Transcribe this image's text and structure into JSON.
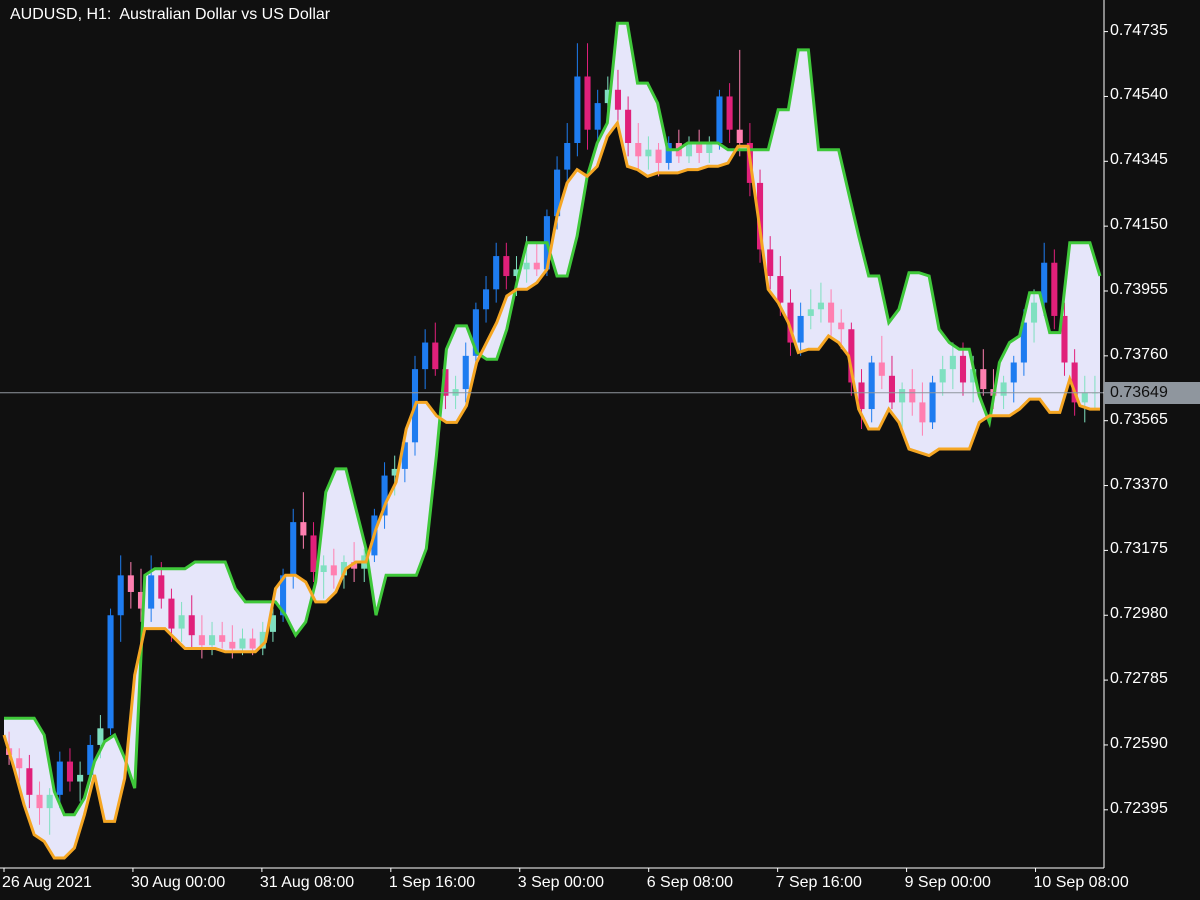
{
  "header": {
    "title": "AUDUSD, H1:  Australian Dollar vs US Dollar"
  },
  "colors": {
    "background": "#101010",
    "axis": "#ffffff",
    "band_fill": "#e6e6fa",
    "upper_band": "#3fc83a",
    "lower_band": "#f5a623",
    "bull_strong": "#1e7cf0",
    "bull_weak": "#7fe0c0",
    "bear_strong": "#e0207a",
    "bear_weak": "#ff7fb0",
    "neutral_candle": "#505050",
    "current_line": "#8f969e"
  },
  "chart_data": {
    "type": "candlestick-with-band",
    "symbol": "AUDUSD",
    "timeframe": "H1",
    "ylim": [
      0.7222,
      0.7483
    ],
    "y_ticks": [
      0.74735,
      0.7454,
      0.74345,
      0.7415,
      0.73955,
      0.7376,
      0.73565,
      0.7337,
      0.73175,
      0.7298,
      0.72785,
      0.7259,
      0.72395
    ],
    "y_tick_labels": [
      "0.74735",
      "0.74540",
      "0.74345",
      "0.74150",
      "0.73955",
      "0.73760",
      "0.73565",
      "0.73370",
      "0.73175",
      "0.72980",
      "0.72785",
      "0.72590",
      "0.72395"
    ],
    "x_tick_labels": [
      "26 Aug 2021",
      "30 Aug 00:00",
      "31 Aug 08:00",
      "1 Sep 16:00",
      "3 Sep 00:00",
      "6 Sep 08:00",
      "7 Sep 16:00",
      "9 Sep 00:00",
      "10 Sep 08:00"
    ],
    "current_price": 0.73649,
    "current_price_label": "0.73649",
    "series": [
      {
        "name": "upper",
        "values": [
          0.7267,
          0.7267,
          0.7267,
          0.7267,
          0.7262,
          0.7245,
          0.7238,
          0.7238,
          0.7243,
          0.7254,
          0.726,
          0.7262,
          0.7255,
          0.7246,
          0.731,
          0.7312,
          0.7312,
          0.7312,
          0.7312,
          0.7314,
          0.7314,
          0.7314,
          0.7314,
          0.7306,
          0.7302,
          0.7302,
          0.7302,
          0.7302,
          0.7298,
          0.7292,
          0.7296,
          0.7308,
          0.7335,
          0.7342,
          0.7342,
          0.733,
          0.7318,
          0.7298,
          0.731,
          0.731,
          0.731,
          0.731,
          0.7318,
          0.7346,
          0.7378,
          0.7385,
          0.7385,
          0.7377,
          0.7375,
          0.7375,
          0.7384,
          0.7398,
          0.741,
          0.741,
          0.741,
          0.74,
          0.74,
          0.7412,
          0.743,
          0.744,
          0.7446,
          0.7476,
          0.7476,
          0.7458,
          0.7458,
          0.7452,
          0.7438,
          0.7438,
          0.744,
          0.744,
          0.744,
          0.744,
          0.7438,
          0.7438,
          0.7438,
          0.7438,
          0.7438,
          0.745,
          0.745,
          0.7468,
          0.7468,
          0.7438,
          0.7438,
          0.7438,
          0.7425,
          0.7412,
          0.74,
          0.74,
          0.7386,
          0.739,
          0.7401,
          0.7401,
          0.74,
          0.7384,
          0.738,
          0.7378,
          0.7378,
          0.7364,
          0.7356,
          0.7374,
          0.738,
          0.7382,
          0.7395,
          0.7395,
          0.7383,
          0.7383,
          0.741,
          0.741,
          0.741,
          0.74
        ],
        "color_key": "upper_band"
      },
      {
        "name": "lower",
        "values": [
          0.7262,
          0.7252,
          0.7241,
          0.7232,
          0.723,
          0.7225,
          0.7225,
          0.7228,
          0.7238,
          0.725,
          0.7236,
          0.7236,
          0.7249,
          0.728,
          0.7294,
          0.7294,
          0.7294,
          0.7291,
          0.7288,
          0.7288,
          0.7288,
          0.7288,
          0.7287,
          0.7287,
          0.7287,
          0.7287,
          0.729,
          0.7306,
          0.731,
          0.731,
          0.7308,
          0.7302,
          0.7302,
          0.7305,
          0.7312,
          0.7314,
          0.7314,
          0.7324,
          0.7332,
          0.7338,
          0.7354,
          0.7362,
          0.7362,
          0.7358,
          0.7356,
          0.7356,
          0.7361,
          0.7374,
          0.738,
          0.7386,
          0.7394,
          0.7396,
          0.7396,
          0.7398,
          0.7402,
          0.7418,
          0.7428,
          0.7432,
          0.743,
          0.7433,
          0.7442,
          0.7446,
          0.7433,
          0.7432,
          0.743,
          0.7431,
          0.7431,
          0.7431,
          0.7432,
          0.7432,
          0.7433,
          0.7433,
          0.7434,
          0.7439,
          0.7439,
          0.7418,
          0.7396,
          0.7392,
          0.7386,
          0.7377,
          0.7378,
          0.7378,
          0.7382,
          0.738,
          0.7376,
          0.736,
          0.7354,
          0.7354,
          0.736,
          0.7356,
          0.7348,
          0.7347,
          0.7346,
          0.7348,
          0.7348,
          0.7348,
          0.7348,
          0.7356,
          0.7358,
          0.7358,
          0.7358,
          0.736,
          0.7363,
          0.7363,
          0.7359,
          0.7359,
          0.7369,
          0.7361,
          0.736,
          0.736
        ],
        "color_key": "lower_band"
      }
    ],
    "candles": [
      [
        0.7258,
        0.7263,
        0.7253,
        0.7256
      ],
      [
        0.7255,
        0.7258,
        0.7248,
        0.7252
      ],
      [
        0.7252,
        0.7256,
        0.724,
        0.7244
      ],
      [
        0.7244,
        0.7248,
        0.7235,
        0.724
      ],
      [
        0.724,
        0.7246,
        0.7232,
        0.7244
      ],
      [
        0.7244,
        0.7257,
        0.724,
        0.7254
      ],
      [
        0.7254,
        0.7258,
        0.7245,
        0.7248
      ],
      [
        0.7248,
        0.7254,
        0.7242,
        0.725
      ],
      [
        0.725,
        0.7262,
        0.7248,
        0.7259
      ],
      [
        0.7259,
        0.7268,
        0.7255,
        0.7264
      ],
      [
        0.7264,
        0.73,
        0.7262,
        0.7298
      ],
      [
        0.7298,
        0.7316,
        0.729,
        0.731
      ],
      [
        0.731,
        0.7314,
        0.73,
        0.7305
      ],
      [
        0.7305,
        0.7312,
        0.7296,
        0.73
      ],
      [
        0.73,
        0.7316,
        0.7296,
        0.731
      ],
      [
        0.731,
        0.7314,
        0.73,
        0.7303
      ],
      [
        0.7303,
        0.7306,
        0.729,
        0.7294
      ],
      [
        0.7294,
        0.7302,
        0.729,
        0.7298
      ],
      [
        0.7298,
        0.7304,
        0.7288,
        0.7292
      ],
      [
        0.7292,
        0.7298,
        0.7285,
        0.7289
      ],
      [
        0.7289,
        0.7296,
        0.7286,
        0.7292
      ],
      [
        0.7292,
        0.7296,
        0.7288,
        0.729
      ],
      [
        0.729,
        0.7295,
        0.7285,
        0.7288
      ],
      [
        0.7288,
        0.7294,
        0.7286,
        0.7291
      ],
      [
        0.7291,
        0.7294,
        0.7286,
        0.7288
      ],
      [
        0.7288,
        0.7296,
        0.7286,
        0.7293
      ],
      [
        0.7293,
        0.73,
        0.729,
        0.7298
      ],
      [
        0.7298,
        0.7312,
        0.7296,
        0.731
      ],
      [
        0.731,
        0.733,
        0.7306,
        0.7326
      ],
      [
        0.7326,
        0.7335,
        0.7318,
        0.7322
      ],
      [
        0.7322,
        0.7326,
        0.7308,
        0.7311
      ],
      [
        0.7311,
        0.7316,
        0.7303,
        0.7313
      ],
      [
        0.7313,
        0.7318,
        0.7306,
        0.731
      ],
      [
        0.731,
        0.7316,
        0.7306,
        0.7314
      ],
      [
        0.7314,
        0.732,
        0.7308,
        0.7312
      ],
      [
        0.7312,
        0.7318,
        0.7308,
        0.7316
      ],
      [
        0.7316,
        0.733,
        0.7314,
        0.7328
      ],
      [
        0.7328,
        0.7344,
        0.7324,
        0.734
      ],
      [
        0.734,
        0.7346,
        0.7334,
        0.7342
      ],
      [
        0.7342,
        0.7352,
        0.7338,
        0.735
      ],
      [
        0.735,
        0.7376,
        0.7346,
        0.7372
      ],
      [
        0.7372,
        0.7384,
        0.7366,
        0.738
      ],
      [
        0.738,
        0.7386,
        0.737,
        0.7372
      ],
      [
        0.7372,
        0.7376,
        0.736,
        0.7364
      ],
      [
        0.7364,
        0.737,
        0.736,
        0.7366
      ],
      [
        0.7366,
        0.738,
        0.7362,
        0.7376
      ],
      [
        0.7376,
        0.7392,
        0.7372,
        0.739
      ],
      [
        0.739,
        0.74,
        0.7386,
        0.7396
      ],
      [
        0.7396,
        0.741,
        0.7392,
        0.7406
      ],
      [
        0.7406,
        0.741,
        0.7396,
        0.74
      ],
      [
        0.74,
        0.7406,
        0.7394,
        0.7402
      ],
      [
        0.7402,
        0.7412,
        0.7398,
        0.7404
      ],
      [
        0.7404,
        0.741,
        0.74,
        0.7402
      ],
      [
        0.7402,
        0.742,
        0.74,
        0.7418
      ],
      [
        0.7418,
        0.7436,
        0.7414,
        0.7432
      ],
      [
        0.7432,
        0.7446,
        0.7428,
        0.744
      ],
      [
        0.744,
        0.747,
        0.7436,
        0.746
      ],
      [
        0.746,
        0.747,
        0.7438,
        0.7444
      ],
      [
        0.7444,
        0.7456,
        0.744,
        0.7452
      ],
      [
        0.7452,
        0.746,
        0.7446,
        0.7456
      ],
      [
        0.7456,
        0.7462,
        0.7446,
        0.745
      ],
      [
        0.745,
        0.7454,
        0.7436,
        0.744
      ],
      [
        0.744,
        0.7446,
        0.7432,
        0.7436
      ],
      [
        0.7436,
        0.7442,
        0.7432,
        0.7438
      ],
      [
        0.7438,
        0.744,
        0.743,
        0.7434
      ],
      [
        0.7434,
        0.7442,
        0.7432,
        0.744
      ],
      [
        0.744,
        0.7444,
        0.7434,
        0.7436
      ],
      [
        0.7436,
        0.7442,
        0.7434,
        0.744
      ],
      [
        0.744,
        0.7444,
        0.7434,
        0.7437
      ],
      [
        0.7437,
        0.7442,
        0.7434,
        0.744
      ],
      [
        0.744,
        0.7456,
        0.7438,
        0.7454
      ],
      [
        0.7454,
        0.7458,
        0.744,
        0.7444
      ],
      [
        0.7444,
        0.7468,
        0.7436,
        0.744
      ],
      [
        0.744,
        0.7446,
        0.7424,
        0.7428
      ],
      [
        0.7428,
        0.7432,
        0.7404,
        0.7408
      ],
      [
        0.7408,
        0.7412,
        0.7396,
        0.74
      ],
      [
        0.74,
        0.7406,
        0.7388,
        0.7392
      ],
      [
        0.7392,
        0.7396,
        0.7376,
        0.738
      ],
      [
        0.738,
        0.7392,
        0.7376,
        0.7388
      ],
      [
        0.7388,
        0.7396,
        0.7384,
        0.739
      ],
      [
        0.739,
        0.7398,
        0.7386,
        0.7392
      ],
      [
        0.7392,
        0.7396,
        0.7382,
        0.7386
      ],
      [
        0.7386,
        0.739,
        0.7378,
        0.7384
      ],
      [
        0.7384,
        0.7386,
        0.7364,
        0.7368
      ],
      [
        0.7368,
        0.7372,
        0.7354,
        0.736
      ],
      [
        0.736,
        0.7376,
        0.7356,
        0.7374
      ],
      [
        0.7374,
        0.7382,
        0.7366,
        0.737
      ],
      [
        0.737,
        0.7376,
        0.736,
        0.7362
      ],
      [
        0.7362,
        0.7368,
        0.7354,
        0.7366
      ],
      [
        0.7366,
        0.7372,
        0.7358,
        0.7362
      ],
      [
        0.7362,
        0.7368,
        0.7352,
        0.7356
      ],
      [
        0.7356,
        0.737,
        0.7354,
        0.7368
      ],
      [
        0.7368,
        0.7376,
        0.7364,
        0.7372
      ],
      [
        0.7372,
        0.738,
        0.7366,
        0.7376
      ],
      [
        0.7376,
        0.738,
        0.7364,
        0.7368
      ],
      [
        0.7368,
        0.7376,
        0.7362,
        0.7372
      ],
      [
        0.7372,
        0.7378,
        0.7364,
        0.7366
      ],
      [
        0.7366,
        0.7372,
        0.736,
        0.7364
      ],
      [
        0.7364,
        0.737,
        0.736,
        0.7368
      ],
      [
        0.7368,
        0.7376,
        0.7362,
        0.7374
      ],
      [
        0.7374,
        0.739,
        0.737,
        0.7386
      ],
      [
        0.7386,
        0.7396,
        0.738,
        0.7392
      ],
      [
        0.7392,
        0.741,
        0.7388,
        0.7404
      ],
      [
        0.7404,
        0.7408,
        0.7384,
        0.7388
      ],
      [
        0.7388,
        0.7392,
        0.737,
        0.7374
      ],
      [
        0.7374,
        0.7378,
        0.7358,
        0.7362
      ],
      [
        0.7362,
        0.737,
        0.7356,
        0.7365
      ],
      [
        0.7365,
        0.737,
        0.736,
        0.7365
      ]
    ]
  }
}
